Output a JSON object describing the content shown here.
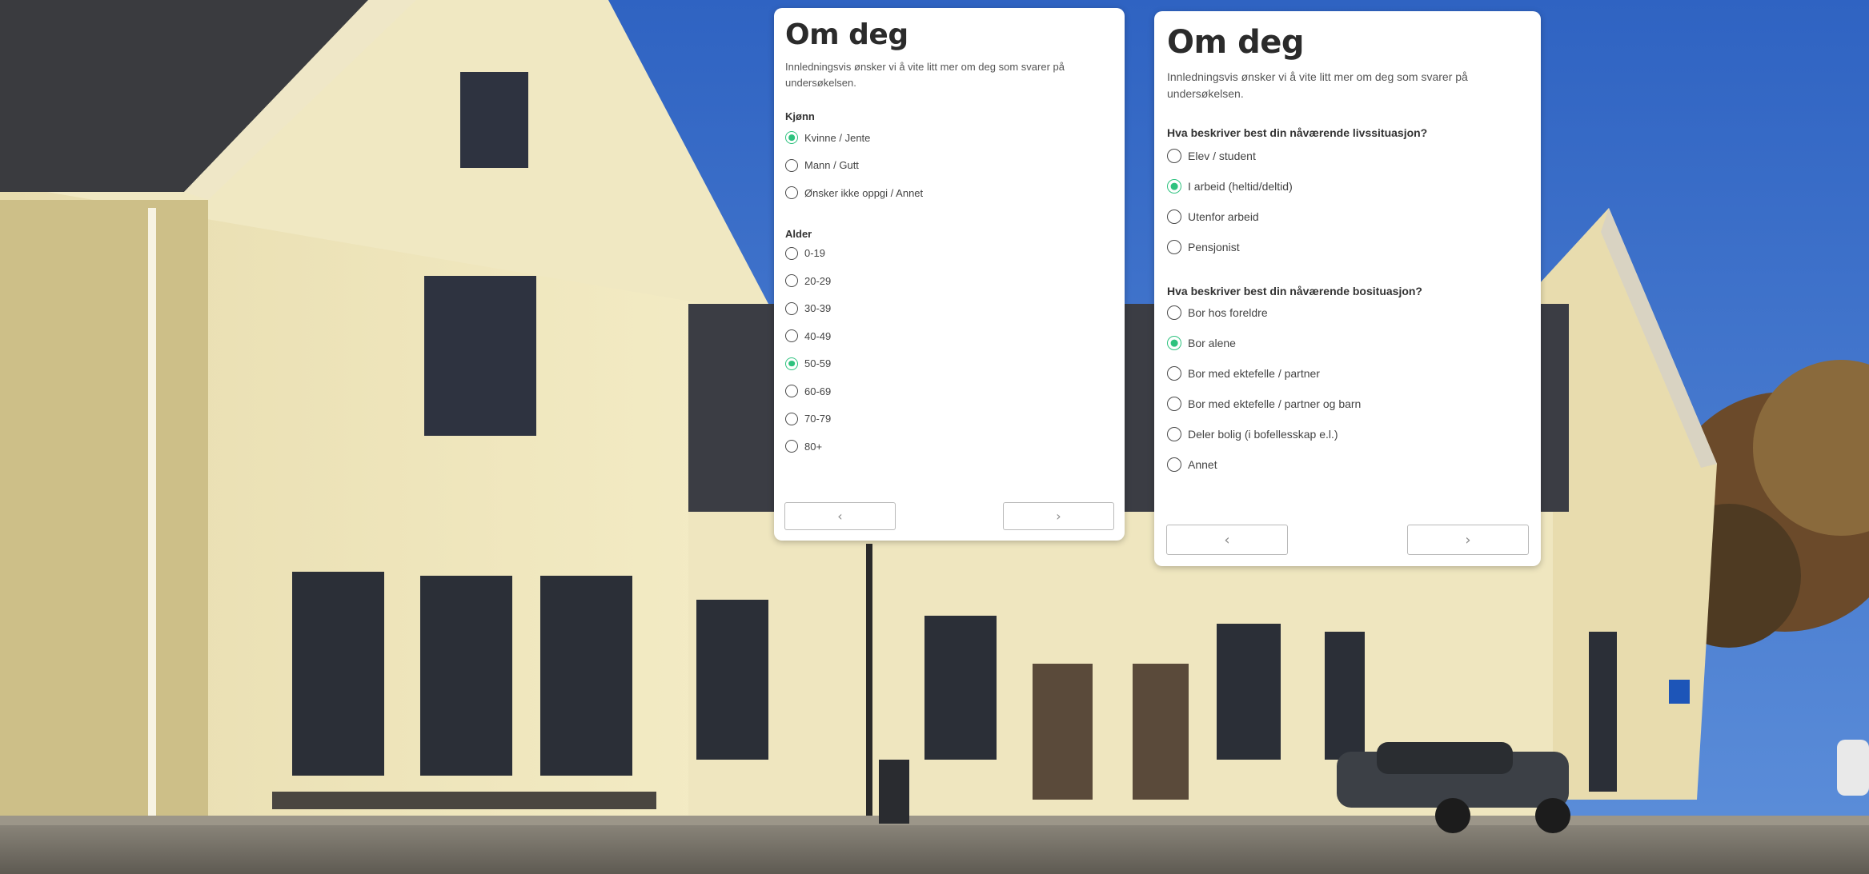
{
  "forms": {
    "left": {
      "title": "Om deg",
      "intro": "Innledningsvis ønsker vi å vite litt mer om deg som svarer på undersøkelsen.",
      "q1": {
        "label": "Kjønn",
        "options": [
          {
            "label": "Kvinne / Jente",
            "selected": true
          },
          {
            "label": "Mann / Gutt",
            "selected": false
          },
          {
            "label": "Ønsker ikke oppgi / Annet",
            "selected": false
          }
        ]
      },
      "q2": {
        "label": "Alder",
        "options": [
          {
            "label": "0-19",
            "selected": false
          },
          {
            "label": "20-29",
            "selected": false
          },
          {
            "label": "30-39",
            "selected": false
          },
          {
            "label": "40-49",
            "selected": false
          },
          {
            "label": "50-59",
            "selected": true
          },
          {
            "label": "60-69",
            "selected": false
          },
          {
            "label": "70-79",
            "selected": false
          },
          {
            "label": "80+",
            "selected": false
          }
        ]
      },
      "nav": {
        "prev": "‹",
        "next": "›"
      }
    },
    "right": {
      "title": "Om deg",
      "intro": "Innledningsvis ønsker vi å vite litt mer om deg som svarer på undersøkelsen.",
      "q1": {
        "label": "Hva beskriver best din nåværende livssituasjon?",
        "options": [
          {
            "label": "Elev / student",
            "selected": false
          },
          {
            "label": "I arbeid (heltid/deltid)",
            "selected": true
          },
          {
            "label": "Utenfor arbeid",
            "selected": false
          },
          {
            "label": "Pensjonist",
            "selected": false
          }
        ]
      },
      "q2": {
        "label": "Hva beskriver best din nåværende bosituasjon?",
        "options": [
          {
            "label": "Bor hos foreldre",
            "selected": false
          },
          {
            "label": "Bor alene",
            "selected": true
          },
          {
            "label": "Bor med ektefelle / partner",
            "selected": false
          },
          {
            "label": "Bor med ektefelle / partner og barn",
            "selected": false
          },
          {
            "label": "Deler bolig (i bofellesskap e.l.)",
            "selected": false
          },
          {
            "label": "Annet",
            "selected": false
          }
        ]
      },
      "nav": {
        "prev": "‹",
        "next": "›"
      }
    }
  },
  "colors": {
    "accent": "#2ec27e",
    "sky": "#3f73c8",
    "facade": "#efe6b4"
  }
}
